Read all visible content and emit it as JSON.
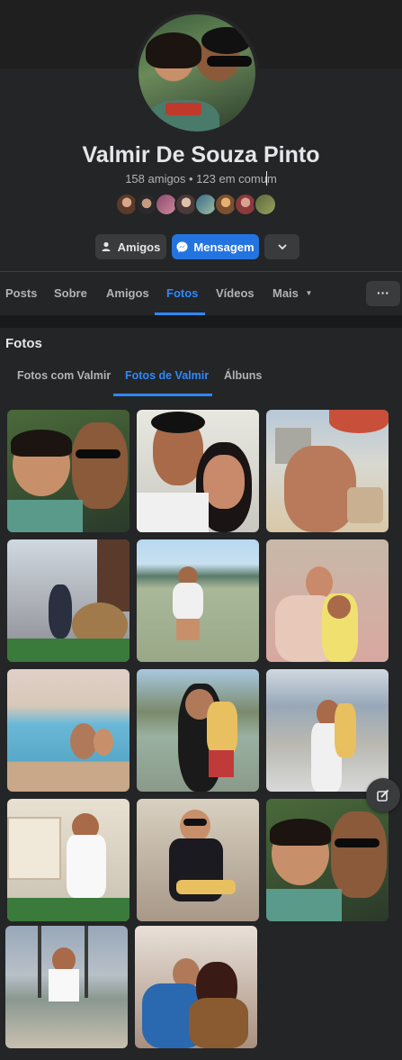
{
  "profile": {
    "name": "Valmir De Souza Pinto",
    "friends_line": "158 amigos • 123 em comum"
  },
  "actions": {
    "friends_button": "Amigos",
    "message_button": "Mensagem",
    "more_icon": "chevron-down-icon"
  },
  "tabs": {
    "items": [
      "Posts",
      "Sobre",
      "Amigos",
      "Fotos",
      "Vídeos",
      "Mais"
    ],
    "active": "Fotos",
    "overflow_icon": "ellipsis-icon",
    "overflow_label": "···"
  },
  "photos": {
    "title": "Fotos",
    "subtabs": [
      "Fotos com Valmir",
      "Fotos de Valmir",
      "Álbuns"
    ],
    "active_subtab": "Fotos de Valmir",
    "count": 14
  },
  "colors": {
    "accent": "#2d88ff",
    "primary_button": "#2374e1",
    "card": "#242526",
    "background": "#18191a"
  }
}
